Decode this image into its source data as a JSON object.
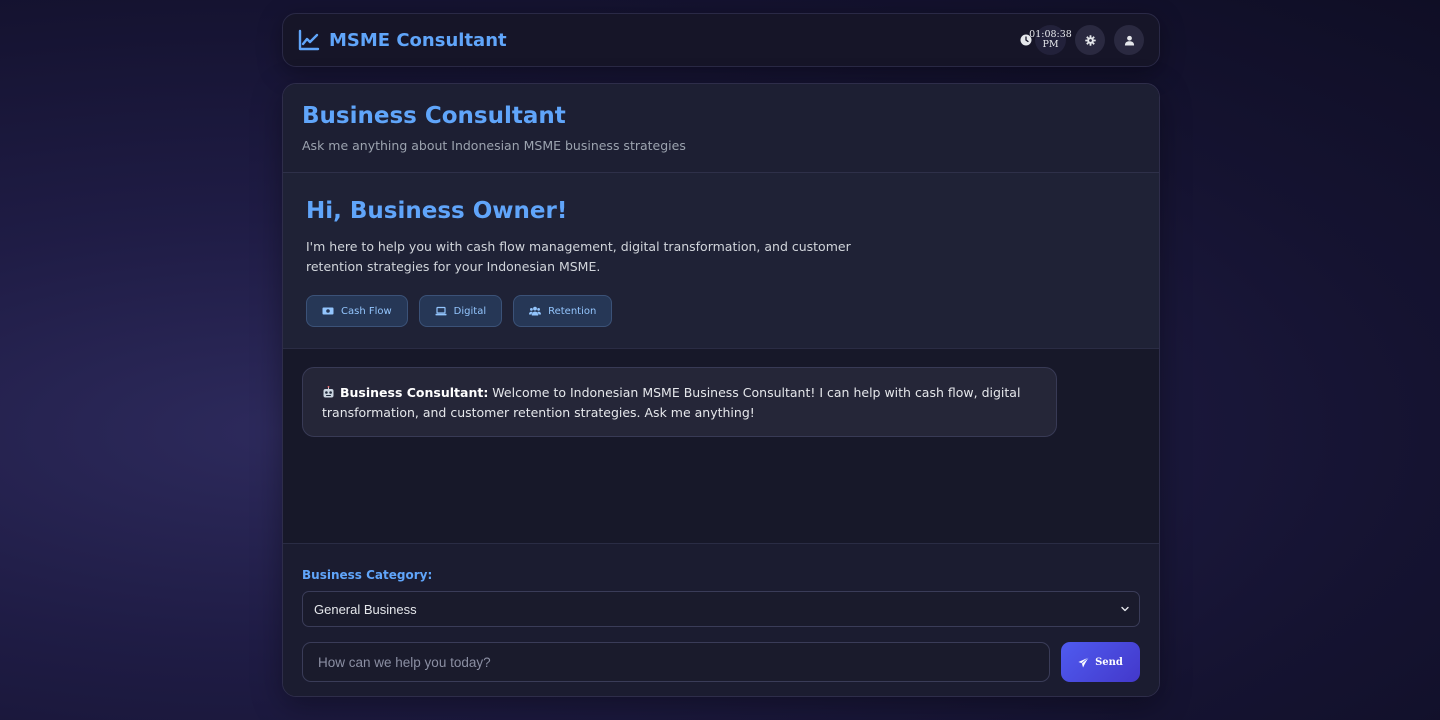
{
  "header": {
    "title": "MSME Consultant",
    "time_line1": "01:08:38",
    "time_line2": "PM",
    "icons": {
      "brand": "chart-line-icon",
      "clock": "clock-icon",
      "settings": "gear-icon",
      "user": "user-icon"
    }
  },
  "panel": {
    "title": "Business Consultant",
    "subtitle": "Ask me anything about Indonesian MSME business strategies"
  },
  "welcome": {
    "title": "Hi, Business Owner!",
    "text": "I'm here to help you with cash flow management, digital transformation, and customer retention strategies for your Indonesian MSME.",
    "chips": [
      {
        "label": "Cash Flow",
        "icon": "money-bill-icon"
      },
      {
        "label": "Digital",
        "icon": "laptop-icon"
      },
      {
        "label": "Retention",
        "icon": "users-icon"
      }
    ]
  },
  "chat": {
    "messages": [
      {
        "sender": "Business Consultant:",
        "text": " Welcome to Indonesian MSME Business Consultant! I can help with cash flow, digital transformation, and customer retention strategies. Ask me anything!",
        "icon": "robot-icon"
      }
    ]
  },
  "composer": {
    "category_label": "Business Category:",
    "category_value": "General Business",
    "input_placeholder": "How can we help you today?",
    "input_value": "",
    "send_label": "Send"
  },
  "colors": {
    "accent": "#60a5fa",
    "send_gradient_start": "#4f5bf0",
    "send_gradient_end": "#4338ca",
    "chip_bg": "#263756"
  }
}
